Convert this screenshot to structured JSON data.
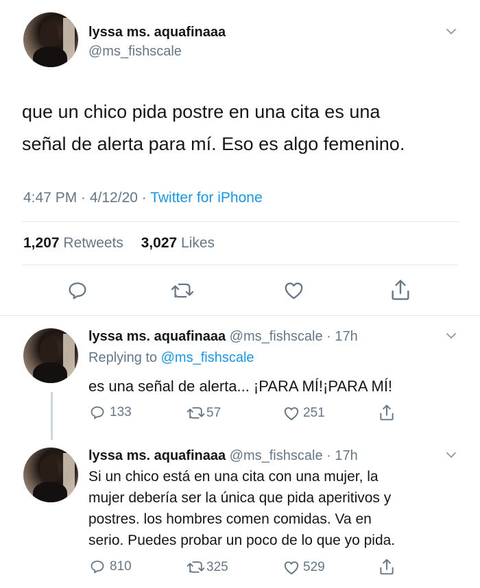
{
  "main_tweet": {
    "author_name": "lyssa ms. aquafinaaa",
    "author_handle": "@ms_fishscale",
    "text_line1": "que un chico pida postre en una cita es una",
    "text_line2": "señal de alerta para mí. Eso es algo femenino.",
    "time": "4:47 PM · 4/12/20 · ",
    "source": "Twitter for iPhone",
    "retweets_count": "1,207",
    "retweets_label": " Retweets",
    "likes_count": "3,027",
    "likes_label": " Likes"
  },
  "replies": [
    {
      "author_name": "lyssa ms. aquafinaaa",
      "author_meta": " @ms_fishscale · 17h",
      "replying_prefix": "Replying to ",
      "replying_to": "@ms_fishscale",
      "text": "es una señal de alerta... ¡PARA MÍ!¡PARA MÍ!",
      "replies_count": "133",
      "retweets_count": "57",
      "likes_count": "251"
    },
    {
      "author_name": "lyssa ms. aquafinaaa",
      "author_meta": " @ms_fishscale · 17h",
      "text_line1": "Si un chico está en una cita con una mujer, la",
      "text_line2": "mujer debería ser la única que pida aperitivos y",
      "text_line3": "postres. los hombres comen comidas. Va en",
      "text_line4": "serio. Puedes probar un poco de lo que yo pida.",
      "replies_count": "810",
      "retweets_count": "325",
      "likes_count": "529"
    }
  ],
  "icons": {
    "reply": "reply-icon",
    "retweet": "retweet-icon",
    "like": "heart-icon",
    "share": "share-icon",
    "menu": "chevron-down-icon"
  },
  "colors": {
    "text": "#14171a",
    "muted": "#657786",
    "link": "#1b95e0",
    "divider": "#e1e8ed"
  }
}
